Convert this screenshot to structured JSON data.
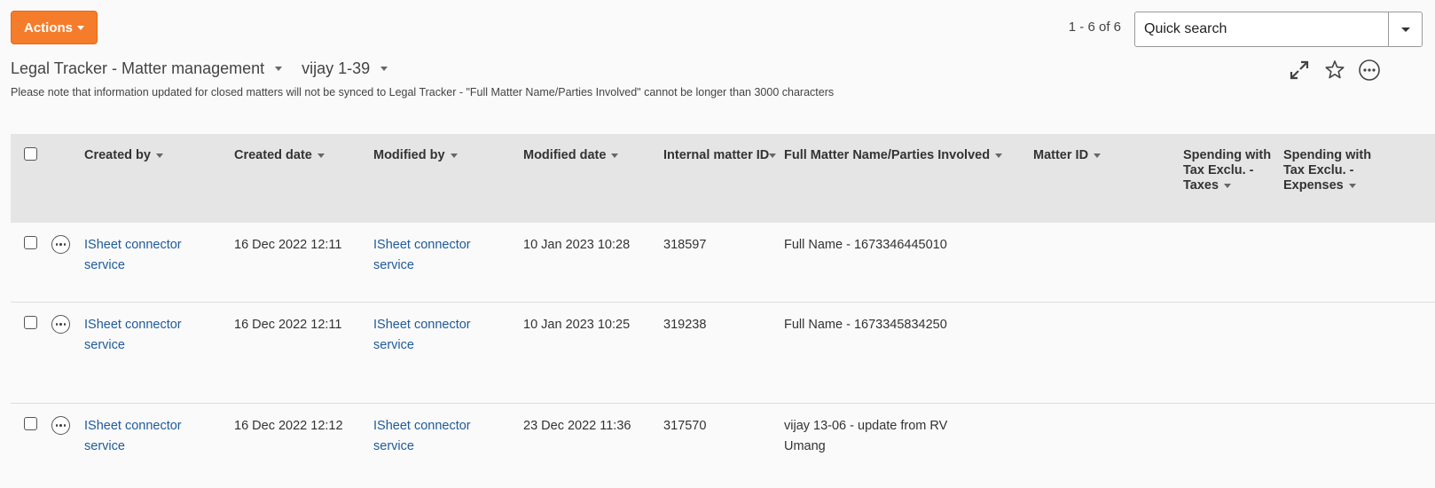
{
  "toolbar": {
    "actions_label": "Actions",
    "pager": "1 - 6 of 6"
  },
  "search": {
    "placeholder": "Quick search"
  },
  "title": {
    "list": "Legal Tracker - Matter management",
    "view": "vijay 1-39"
  },
  "notice": "Please note that information updated for closed matters will not be synced to Legal Tracker - \"Full Matter Name/Parties Involved\" cannot be longer than 3000 characters",
  "icons": {
    "expand": "expand-icon",
    "favorite": "star-icon",
    "more": "more-options-icon"
  },
  "columns": [
    {
      "label": "Created by"
    },
    {
      "label": "Created date"
    },
    {
      "label": "Modified by"
    },
    {
      "label": "Modified date"
    },
    {
      "label": "Internal matter ID"
    },
    {
      "label": "Full Matter Name/Parties Involved"
    },
    {
      "label": "Matter ID"
    },
    {
      "label": "Spending with Tax Exclu. - Taxes"
    },
    {
      "label": "Spending with Tax Exclu. - Expenses"
    }
  ],
  "rows": [
    {
      "created_by": "ISheet connector service",
      "created_date": "16 Dec 2022 12:11",
      "modified_by": "ISheet connector service",
      "modified_date": "10 Jan 2023 10:28",
      "internal_id": "318597",
      "full_name": "Full Name - 1673346445010",
      "matter_id": "",
      "taxes": "",
      "expenses": ""
    },
    {
      "created_by": "ISheet connector service",
      "created_date": "16 Dec 2022 12:11",
      "modified_by": "ISheet connector service",
      "modified_date": "10 Jan 2023 10:25",
      "internal_id": "319238",
      "full_name": "Full Name - 1673345834250",
      "matter_id": "",
      "taxes": "",
      "expenses": ""
    },
    {
      "created_by": "ISheet connector service",
      "created_date": "16 Dec 2022 12:12",
      "modified_by": "ISheet connector service",
      "modified_date": "23 Dec 2022 11:36",
      "internal_id": "317570",
      "full_name": "vijay 13-06 - update from RV Umang",
      "matter_id": "",
      "taxes": "",
      "expenses": ""
    }
  ],
  "colors": {
    "accent": "#f57c2b",
    "link": "#1f5b99",
    "header_bg": "#e5e5e5"
  }
}
